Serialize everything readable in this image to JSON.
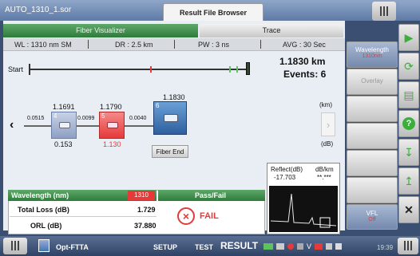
{
  "window": {
    "file_name": "AUTO_1310_1.sor",
    "center_tab": "Result File Browser"
  },
  "tabs": {
    "fiber_visualizer": "Fiber Visualizer",
    "trace": "Trace"
  },
  "params": {
    "wl": "WL : 1310 nm SM",
    "dr": "DR : 2.5 km",
    "pw": "PW : 3 ns",
    "avg": "AVG : 30 Sec"
  },
  "summary": {
    "distance": "1.1830 km",
    "events": "Events: 6",
    "start_label": "Start"
  },
  "events": [
    {
      "number": "4",
      "distance": "1.1691",
      "loss": "0.153",
      "status": "pass"
    },
    {
      "number": "5",
      "distance": "1.1790",
      "loss": "1.130",
      "status": "fail"
    },
    {
      "number": "6",
      "distance": "1.1830",
      "label": "Fiber End",
      "status": "end"
    }
  ],
  "spans": [
    "0.0515",
    "0.0099",
    "0.0040"
  ],
  "units": {
    "km": "(km)",
    "db": "(dB)"
  },
  "reflect": {
    "header_left": "Reflect(dB)",
    "header_right": "dB/km",
    "value_left": "-17.703",
    "value_right": "**.***"
  },
  "results": {
    "wavelength_label": "Wavelength (nm)",
    "wavelength_value": "1310",
    "total_loss_label": "Total Loss (dB)",
    "total_loss_value": "1.729",
    "orl_label": "ORL (dB)",
    "orl_value": "37.880",
    "passfail_label": "Pass/Fail",
    "status": "FAIL"
  },
  "right_panel": {
    "wavelength_btn": "Wavelength",
    "wavelength_sub": "1310nm",
    "overlay_btn": "Overlay",
    "vfl_btn": "VFL",
    "vfl_sub": "Off"
  },
  "bottombar": {
    "app_name": "Opt-FTTA",
    "setup": "SETUP",
    "test": "TEST",
    "result": "RESULT",
    "time": "19:39"
  },
  "colors": {
    "accent_green": "#2e7b3b",
    "fail_red": "#e53a3a",
    "bar_blue": "#3a4f72"
  }
}
